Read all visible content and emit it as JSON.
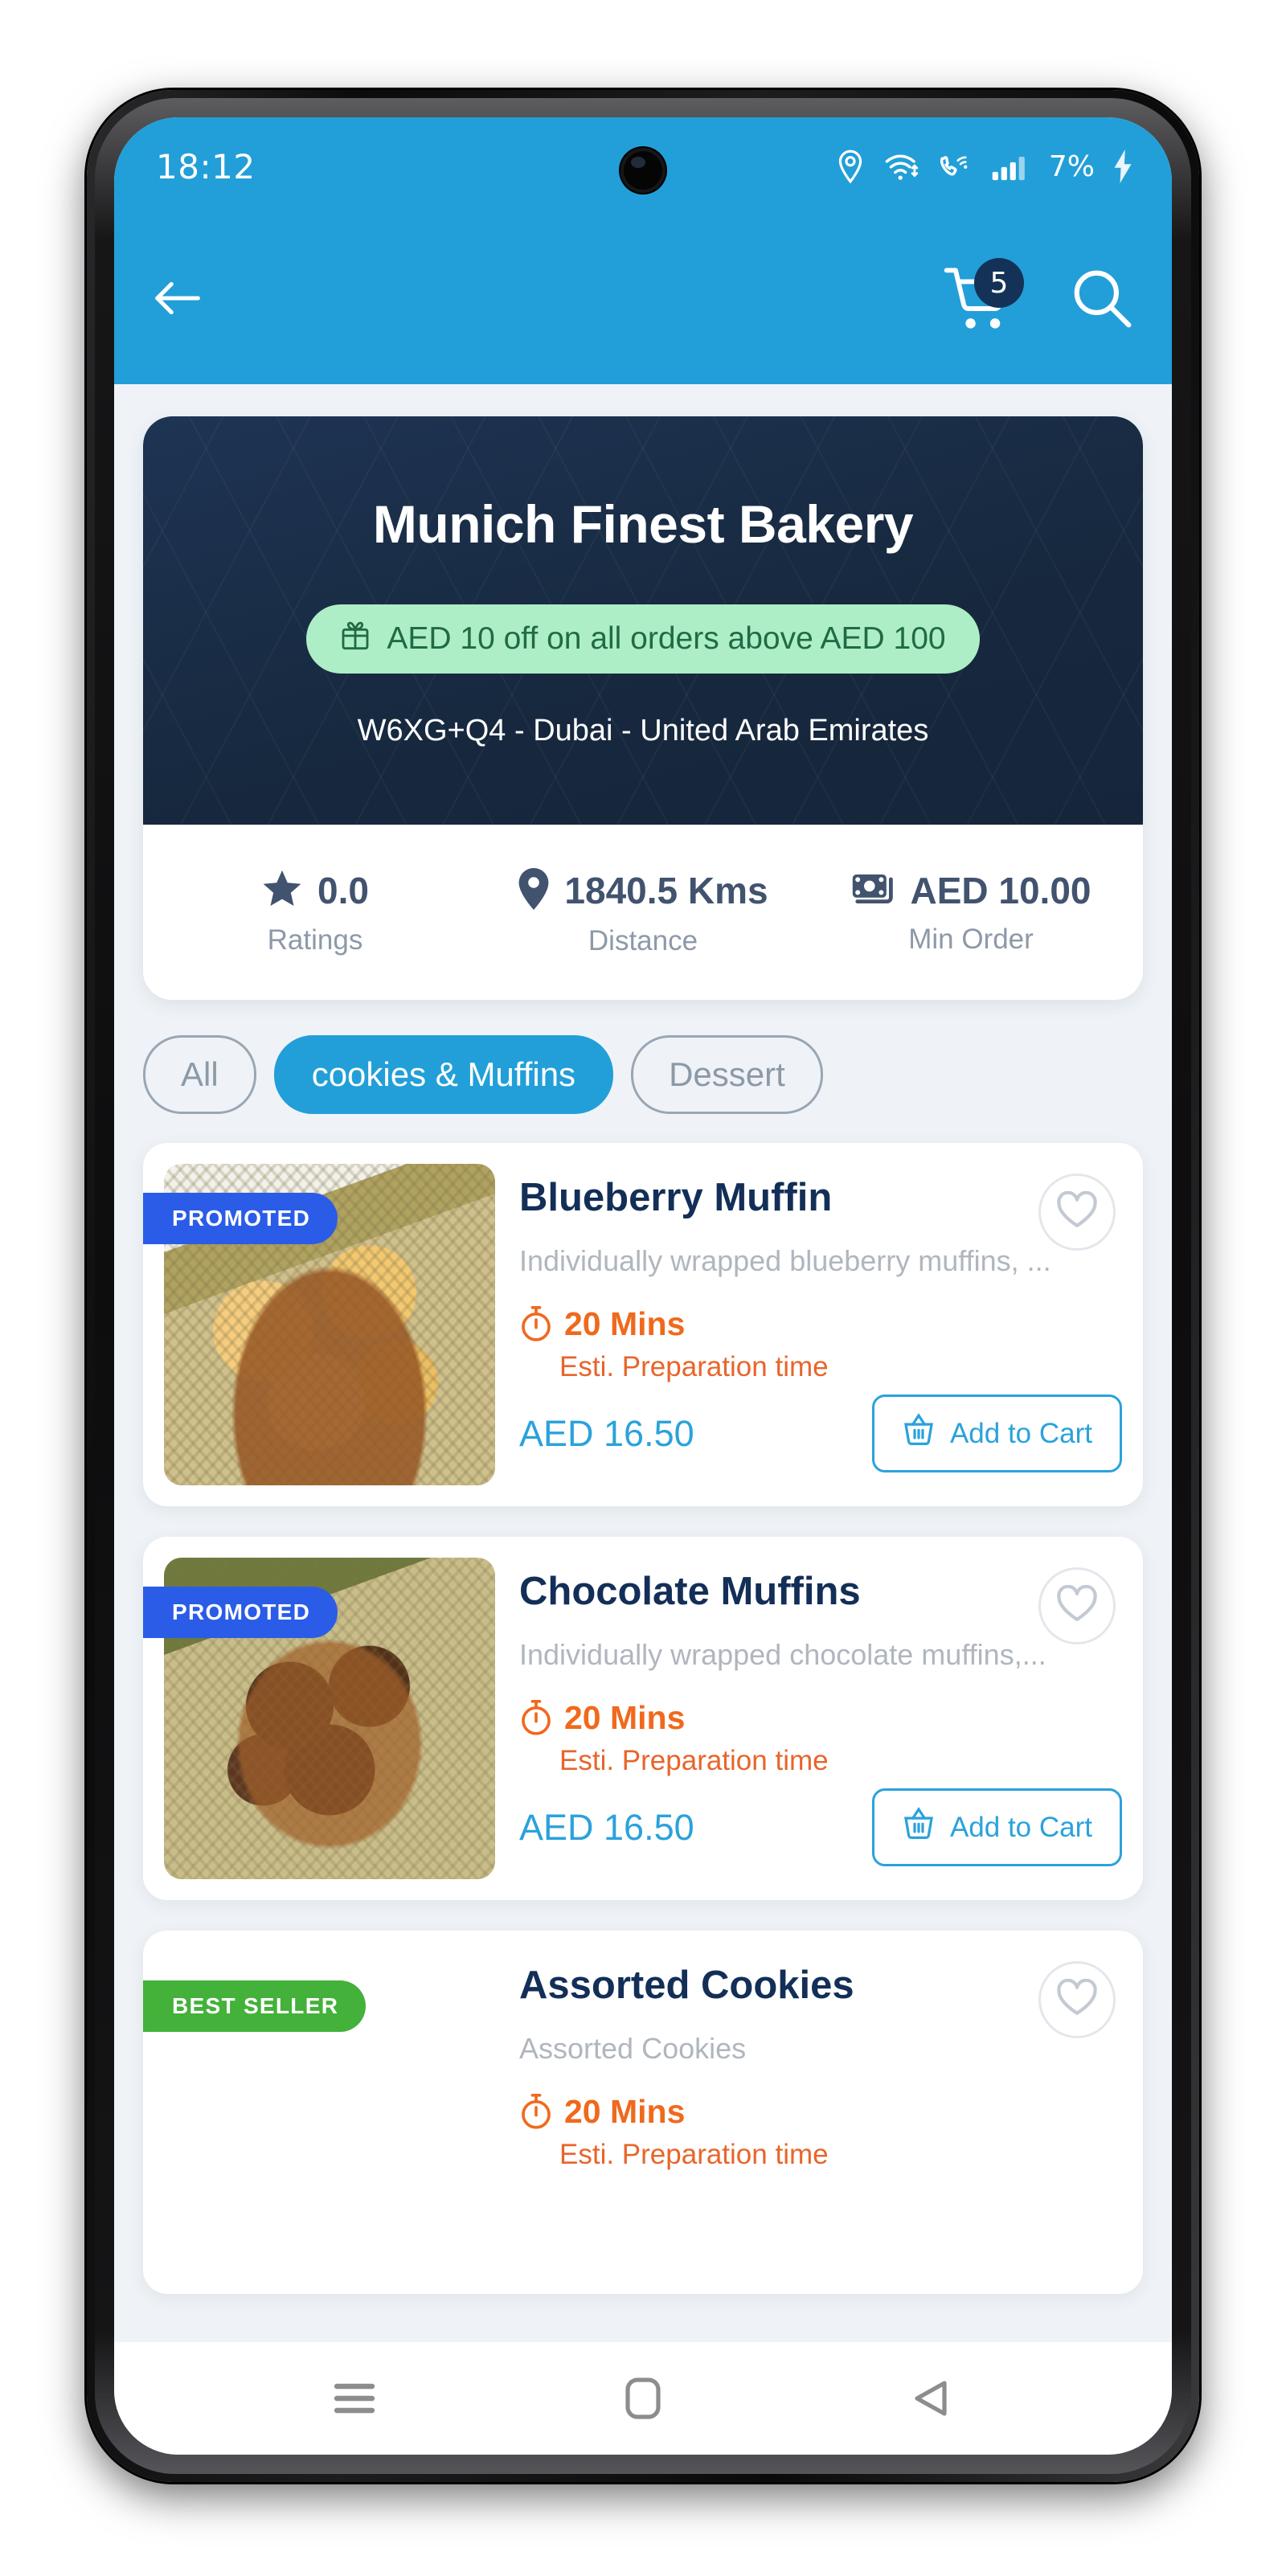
{
  "status_bar": {
    "time": "18:12",
    "battery_percent": "7%",
    "icons": [
      "location-icon",
      "wifi-icon",
      "call-wifi-icon",
      "signal-icon",
      "charging-bolt-icon"
    ]
  },
  "app_bar": {
    "back_icon": "back-arrow-icon",
    "cart_icon": "cart-icon",
    "cart_badge_count": "5",
    "search_icon": "search-icon",
    "background_color": "#229fd8"
  },
  "store": {
    "name": "Munich Finest Bakery",
    "promo_text": "AED 10 off on all orders above AED 100",
    "promo_icon": "gift-icon",
    "promo_bg": "#aeeec6",
    "promo_fg": "#1f6b45",
    "address": "W6XG+Q4 - Dubai - United Arab Emirates",
    "banner_color": "#1e3454",
    "stats": [
      {
        "icon": "star-icon",
        "value": "0.0",
        "label": "Ratings"
      },
      {
        "icon": "pin-icon",
        "value": "1840.5 Kms",
        "label": "Distance"
      },
      {
        "icon": "money-icon",
        "value": "AED 10.00",
        "label": "Min Order"
      }
    ]
  },
  "categories": [
    {
      "label": "All",
      "active": false
    },
    {
      "label": "cookies & Muffins",
      "active": true
    },
    {
      "label": "Dessert",
      "active": false
    }
  ],
  "products": [
    {
      "title": "Blueberry Muffin",
      "description": "Individually wrapped blueberry muffins, ...",
      "badge": "PROMOTED",
      "badge_color": "#2a5ce8",
      "prep_time": "20 Mins",
      "prep_label": "Esti. Preparation time",
      "price": "AED 16.50",
      "add_to_cart_label": "Add to Cart",
      "favorite_icon": "heart-outline-icon",
      "timer_icon": "stopwatch-icon",
      "basket_icon": "basket-icon"
    },
    {
      "title": "Chocolate Muffins",
      "description": "Individually wrapped chocolate muffins,...",
      "badge": "PROMOTED",
      "badge_color": "#2a5ce8",
      "prep_time": "20 Mins",
      "prep_label": "Esti. Preparation time",
      "price": "AED 16.50",
      "add_to_cart_label": "Add to Cart",
      "favorite_icon": "heart-outline-icon",
      "timer_icon": "stopwatch-icon",
      "basket_icon": "basket-icon"
    },
    {
      "title": "Assorted Cookies",
      "description": "Assorted Cookies",
      "badge": "BEST SELLER",
      "badge_color": "#44b13a",
      "prep_time": "20 Mins",
      "prep_label": "Esti. Preparation time",
      "price": "",
      "add_to_cart_label": "",
      "favorite_icon": "heart-outline-icon",
      "timer_icon": "stopwatch-icon",
      "basket_icon": "basket-icon"
    }
  ],
  "nav_bar": {
    "recents_icon": "menu-icon",
    "home_icon": "home-square-icon",
    "back_icon": "back-triangle-icon"
  }
}
